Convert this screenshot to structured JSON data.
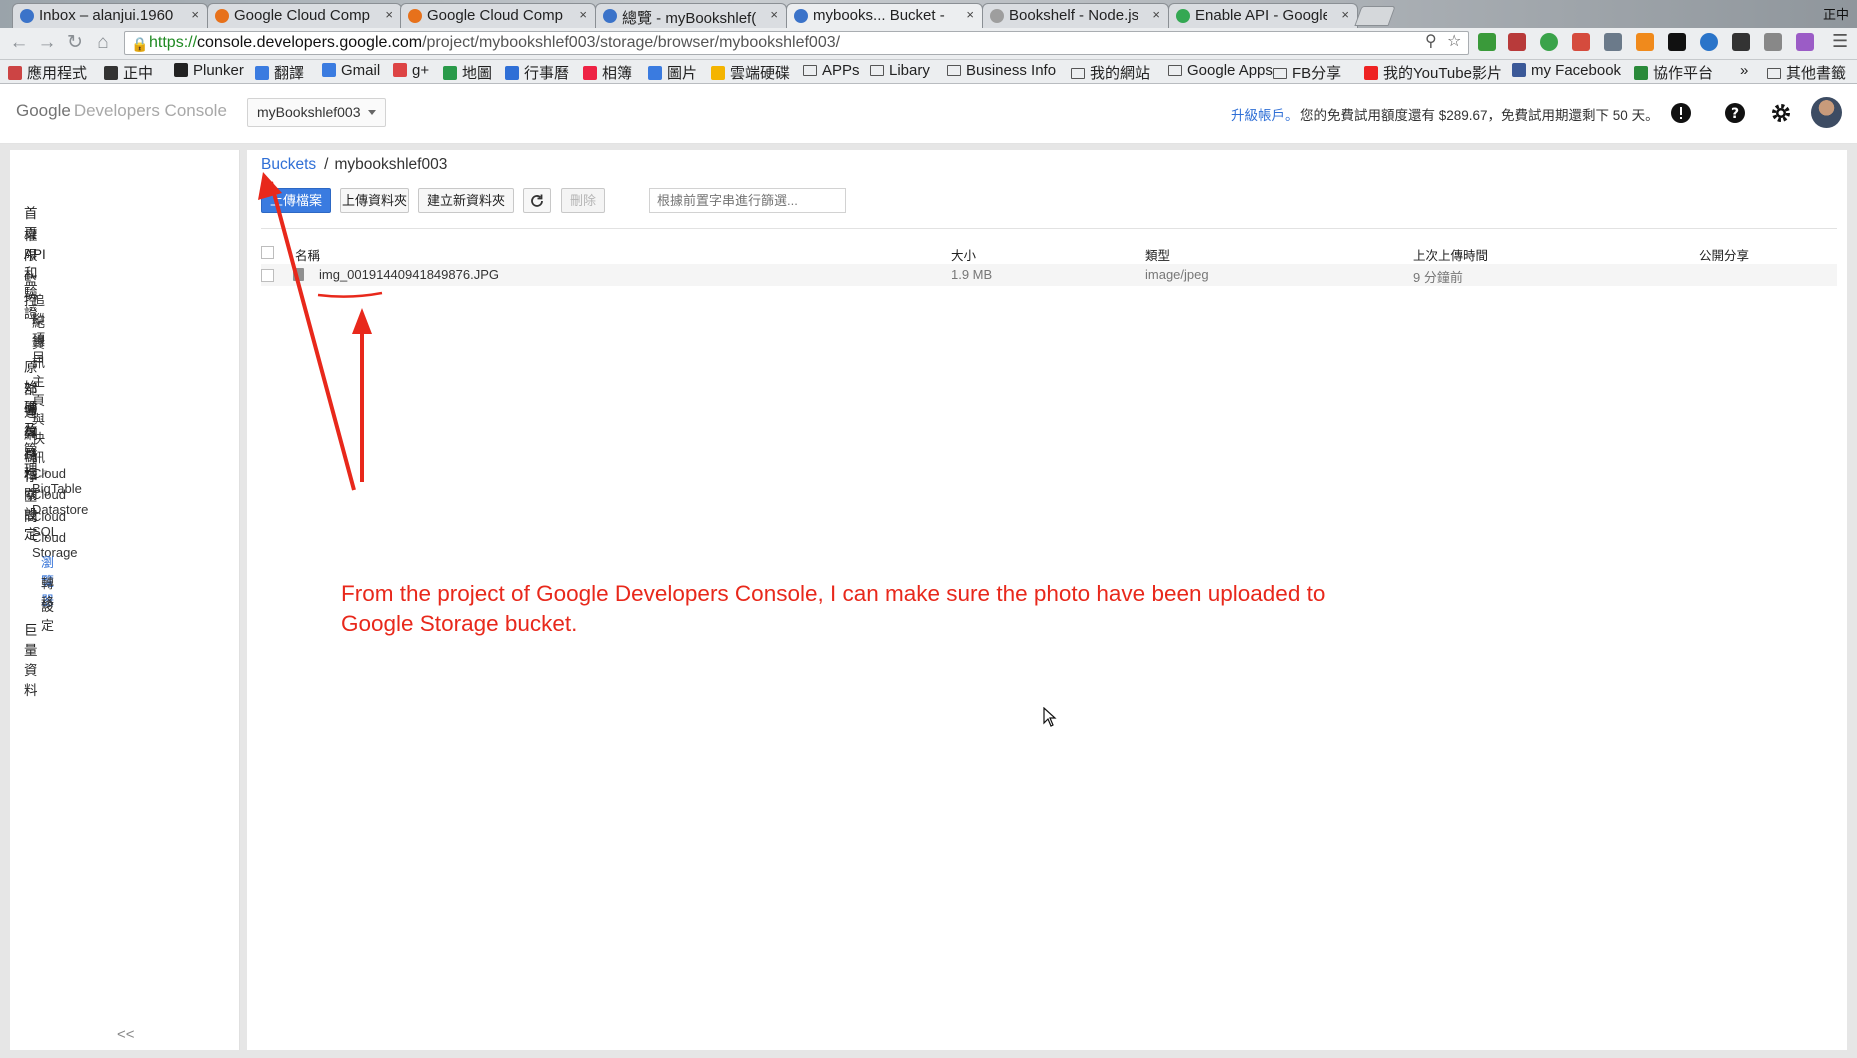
{
  "browser": {
    "tabs": [
      {
        "title": "Inbox – alanjui.1960",
        "favicon_color": "#3b73c9"
      },
      {
        "title": "Google Cloud Comp",
        "favicon_color": "#e7711b"
      },
      {
        "title": "Google Cloud Comp",
        "favicon_color": "#e7711b"
      },
      {
        "title": "總覽 - myBookshlef(",
        "favicon_color": "#3b73c9"
      },
      {
        "title": "mybooks... Bucket -",
        "favicon_color": "#3b73c9"
      },
      {
        "title": "Bookshelf - Node.js",
        "favicon_color": "#9e9e9e"
      },
      {
        "title": "Enable API - Google",
        "favicon_color": "#34a853"
      }
    ],
    "close_glyph": "×",
    "clock": "正中",
    "address": {
      "scheme": "https://",
      "host": "console.developers.google.com",
      "path": "/project/mybookshlef003/storage/browser/mybookshlef003/"
    },
    "bookmarks": [
      "應用程式",
      "正中",
      "Plunker",
      "翻譯",
      "Gmail",
      "g+",
      "地圖",
      "行事曆",
      "相簿",
      "圖片",
      "雲端硬碟",
      "APPs",
      "Libary",
      "Business Info",
      "我的網站",
      "Google Apps",
      "FB分享",
      "我的YouTube影片",
      "my Facebook",
      "協作平台",
      "»",
      "其他書籤"
    ]
  },
  "header": {
    "logo_google": "Google",
    "logo_product": "Developers Console",
    "project": "myBookshlef003",
    "upgrade_link": "升級帳戶。",
    "trial_text": "您的免費試用額度還有 $289.67，免費試用期還剩下 50 天。",
    "icons": [
      "feedback-icon",
      "help-icon",
      "settings-icon",
      "avatar"
    ]
  },
  "sidebar": {
    "items": [
      {
        "label": "首頁",
        "level": 0
      },
      {
        "label": "權限",
        "level": 0
      },
      {
        "label": "API 和驗證",
        "level": 0
      },
      {
        "label": "監控",
        "level": 0
      },
      {
        "label": "追蹤項目",
        "level": 1
      },
      {
        "label": "紀錄",
        "level": 1
      },
      {
        "label": "資訊主頁與快訊",
        "level": 1
      },
      {
        "label": "原始碼",
        "level": 0
      },
      {
        "label": "部署及管理",
        "level": 0
      },
      {
        "label": "運算",
        "level": 0
      },
      {
        "label": "網路相關設定",
        "level": 0
      },
      {
        "label": "儲存空間",
        "level": 0
      },
      {
        "label": "Cloud BigTable",
        "level": 1
      },
      {
        "label": "Cloud Datastore",
        "level": 1
      },
      {
        "label": "Cloud SQL",
        "level": 1
      },
      {
        "label": "Cloud Storage",
        "level": 1
      },
      {
        "label": "瀏覽器",
        "level": 2
      },
      {
        "label": "轉移",
        "level": 2
      },
      {
        "label": "設定",
        "level": 2
      },
      {
        "label": "巨量資料",
        "level": 0
      }
    ],
    "collapse": "<<"
  },
  "main": {
    "breadcrumb": {
      "link": "Buckets",
      "separator": "/",
      "current": "mybookshlef003"
    },
    "toolbar": {
      "upload_files": "上傳檔案",
      "upload_folder": "上傳資料夾",
      "new_folder": "建立新資料夾",
      "delete": "刪除",
      "filter_placeholder": "根據前置字串進行篩選..."
    },
    "table": {
      "columns": [
        "名稱",
        "大小",
        "類型",
        "上次上傳時間",
        "公開分享"
      ],
      "rows": [
        {
          "name": "img_00191440941849876.JPG",
          "size": "1.9 MB",
          "type": "image/jpeg",
          "uploaded": "9 分鐘前"
        }
      ]
    }
  },
  "annotation": {
    "text": "From the project of Google Developers Console, I can make sure the photo have been uploaded to Google Storage bucket.",
    "color": "#e8281b"
  }
}
